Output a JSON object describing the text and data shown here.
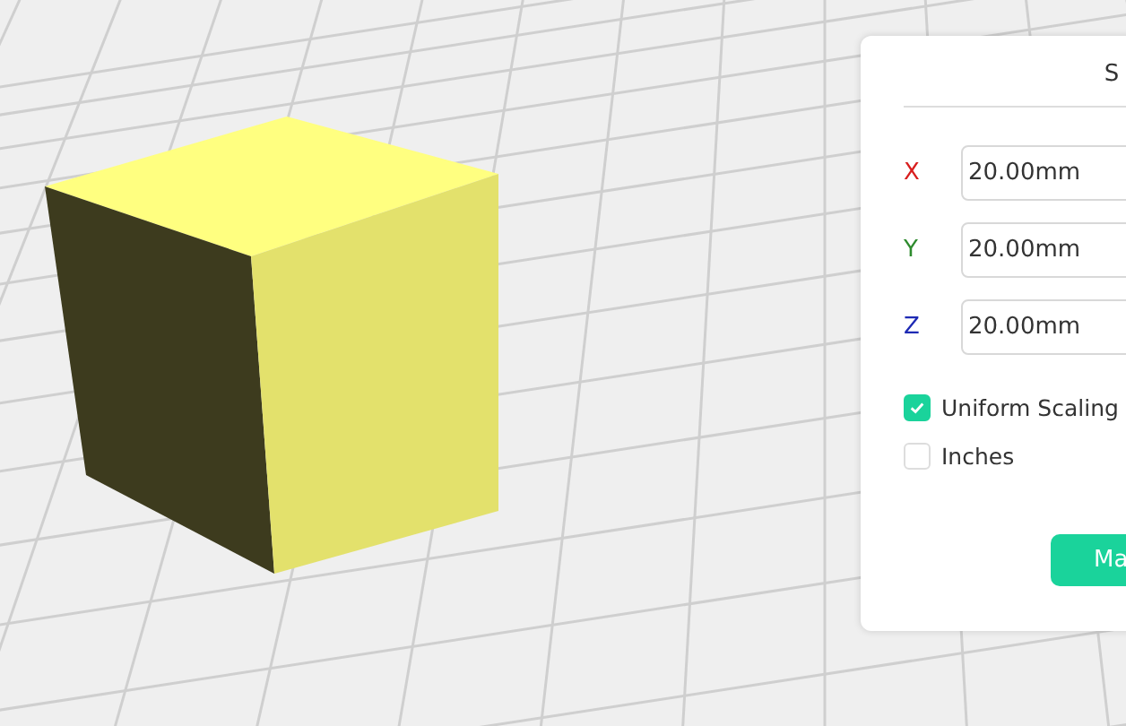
{
  "panel": {
    "title": "S",
    "axes": [
      {
        "label": "X",
        "color": "#d81e1e",
        "value": "20.00mm"
      },
      {
        "label": "Y",
        "color": "#2e8b2e",
        "value": "20.00mm"
      },
      {
        "label": "Z",
        "color": "#1e2ab4",
        "value": "20.00mm"
      }
    ],
    "options": [
      {
        "label": "Uniform Scaling",
        "checked": true
      },
      {
        "label": "Inches",
        "checked": false
      }
    ],
    "button": "Ma"
  }
}
